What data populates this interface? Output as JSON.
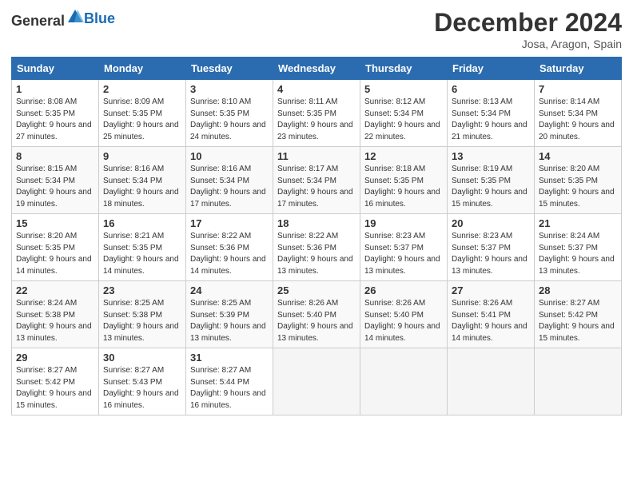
{
  "header": {
    "logo_general": "General",
    "logo_blue": "Blue",
    "title": "December 2024",
    "location": "Josa, Aragon, Spain"
  },
  "days_of_week": [
    "Sunday",
    "Monday",
    "Tuesday",
    "Wednesday",
    "Thursday",
    "Friday",
    "Saturday"
  ],
  "weeks": [
    [
      {
        "day": 1,
        "info": "Sunrise: 8:08 AM\nSunset: 5:35 PM\nDaylight: 9 hours and 27 minutes."
      },
      {
        "day": 2,
        "info": "Sunrise: 8:09 AM\nSunset: 5:35 PM\nDaylight: 9 hours and 25 minutes."
      },
      {
        "day": 3,
        "info": "Sunrise: 8:10 AM\nSunset: 5:35 PM\nDaylight: 9 hours and 24 minutes."
      },
      {
        "day": 4,
        "info": "Sunrise: 8:11 AM\nSunset: 5:35 PM\nDaylight: 9 hours and 23 minutes."
      },
      {
        "day": 5,
        "info": "Sunrise: 8:12 AM\nSunset: 5:34 PM\nDaylight: 9 hours and 22 minutes."
      },
      {
        "day": 6,
        "info": "Sunrise: 8:13 AM\nSunset: 5:34 PM\nDaylight: 9 hours and 21 minutes."
      },
      {
        "day": 7,
        "info": "Sunrise: 8:14 AM\nSunset: 5:34 PM\nDaylight: 9 hours and 20 minutes."
      }
    ],
    [
      {
        "day": 8,
        "info": "Sunrise: 8:15 AM\nSunset: 5:34 PM\nDaylight: 9 hours and 19 minutes."
      },
      {
        "day": 9,
        "info": "Sunrise: 8:16 AM\nSunset: 5:34 PM\nDaylight: 9 hours and 18 minutes."
      },
      {
        "day": 10,
        "info": "Sunrise: 8:16 AM\nSunset: 5:34 PM\nDaylight: 9 hours and 17 minutes."
      },
      {
        "day": 11,
        "info": "Sunrise: 8:17 AM\nSunset: 5:34 PM\nDaylight: 9 hours and 17 minutes."
      },
      {
        "day": 12,
        "info": "Sunrise: 8:18 AM\nSunset: 5:35 PM\nDaylight: 9 hours and 16 minutes."
      },
      {
        "day": 13,
        "info": "Sunrise: 8:19 AM\nSunset: 5:35 PM\nDaylight: 9 hours and 15 minutes."
      },
      {
        "day": 14,
        "info": "Sunrise: 8:20 AM\nSunset: 5:35 PM\nDaylight: 9 hours and 15 minutes."
      }
    ],
    [
      {
        "day": 15,
        "info": "Sunrise: 8:20 AM\nSunset: 5:35 PM\nDaylight: 9 hours and 14 minutes."
      },
      {
        "day": 16,
        "info": "Sunrise: 8:21 AM\nSunset: 5:35 PM\nDaylight: 9 hours and 14 minutes."
      },
      {
        "day": 17,
        "info": "Sunrise: 8:22 AM\nSunset: 5:36 PM\nDaylight: 9 hours and 14 minutes."
      },
      {
        "day": 18,
        "info": "Sunrise: 8:22 AM\nSunset: 5:36 PM\nDaylight: 9 hours and 13 minutes."
      },
      {
        "day": 19,
        "info": "Sunrise: 8:23 AM\nSunset: 5:37 PM\nDaylight: 9 hours and 13 minutes."
      },
      {
        "day": 20,
        "info": "Sunrise: 8:23 AM\nSunset: 5:37 PM\nDaylight: 9 hours and 13 minutes."
      },
      {
        "day": 21,
        "info": "Sunrise: 8:24 AM\nSunset: 5:37 PM\nDaylight: 9 hours and 13 minutes."
      }
    ],
    [
      {
        "day": 22,
        "info": "Sunrise: 8:24 AM\nSunset: 5:38 PM\nDaylight: 9 hours and 13 minutes."
      },
      {
        "day": 23,
        "info": "Sunrise: 8:25 AM\nSunset: 5:38 PM\nDaylight: 9 hours and 13 minutes."
      },
      {
        "day": 24,
        "info": "Sunrise: 8:25 AM\nSunset: 5:39 PM\nDaylight: 9 hours and 13 minutes."
      },
      {
        "day": 25,
        "info": "Sunrise: 8:26 AM\nSunset: 5:40 PM\nDaylight: 9 hours and 13 minutes."
      },
      {
        "day": 26,
        "info": "Sunrise: 8:26 AM\nSunset: 5:40 PM\nDaylight: 9 hours and 14 minutes."
      },
      {
        "day": 27,
        "info": "Sunrise: 8:26 AM\nSunset: 5:41 PM\nDaylight: 9 hours and 14 minutes."
      },
      {
        "day": 28,
        "info": "Sunrise: 8:27 AM\nSunset: 5:42 PM\nDaylight: 9 hours and 15 minutes."
      }
    ],
    [
      {
        "day": 29,
        "info": "Sunrise: 8:27 AM\nSunset: 5:42 PM\nDaylight: 9 hours and 15 minutes."
      },
      {
        "day": 30,
        "info": "Sunrise: 8:27 AM\nSunset: 5:43 PM\nDaylight: 9 hours and 16 minutes."
      },
      {
        "day": 31,
        "info": "Sunrise: 8:27 AM\nSunset: 5:44 PM\nDaylight: 9 hours and 16 minutes."
      },
      null,
      null,
      null,
      null
    ]
  ]
}
